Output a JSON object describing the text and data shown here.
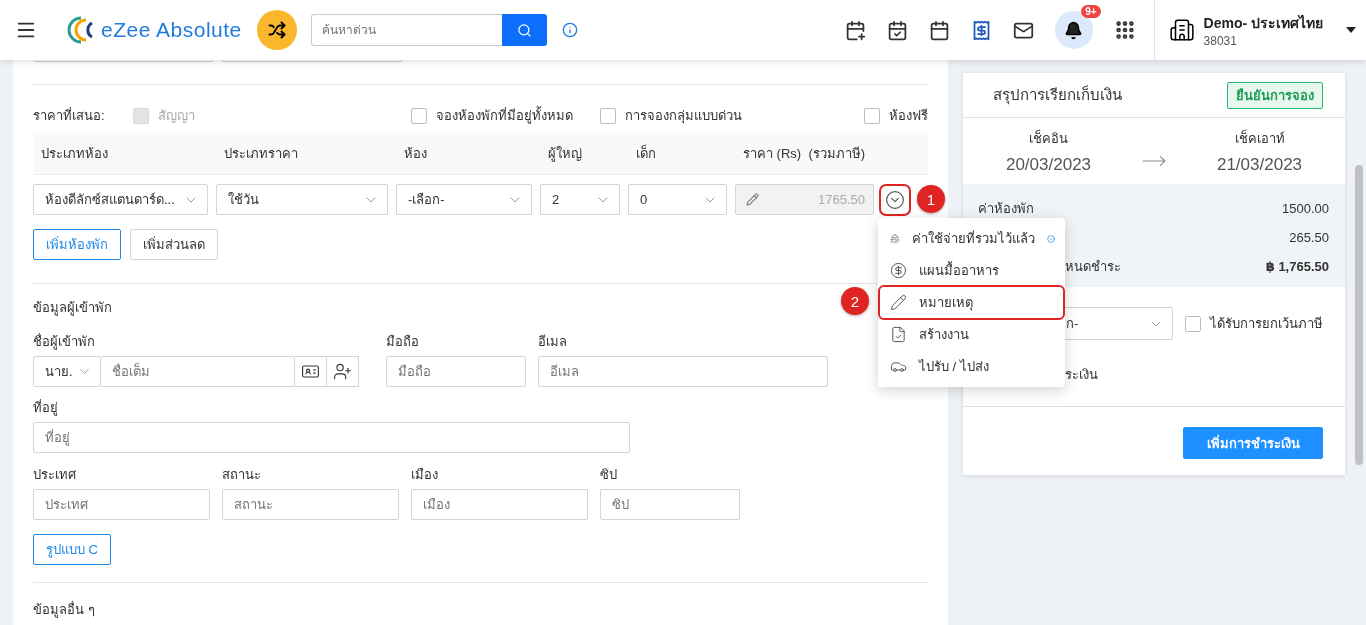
{
  "header": {
    "logo_text": "eZee Absolute",
    "search": {
      "placeholder": "ค้นหาด่วน"
    },
    "notification_badge": "9+",
    "property": {
      "name": "Demo- ประเทศไทย",
      "code": "38031"
    }
  },
  "booking": {
    "offered_rate_label": "ราคาที่เสนอ:",
    "options": [
      {
        "label": "สัญญา",
        "checked": false,
        "disabled": true
      },
      {
        "label": "จองห้องพักที่มีอยู่ทั้งหมด",
        "checked": false,
        "disabled": false
      },
      {
        "label": "การจองกลุ่มแบบด่วน",
        "checked": false,
        "disabled": false
      },
      {
        "label": "ห้องฟรี",
        "checked": false,
        "disabled": false
      }
    ],
    "columns": [
      "ประเภทห้อง",
      "ประเภทราคา",
      "ห้อง",
      "ผู้ใหญ่",
      "เด็ก",
      "ราคา (Rs)  (รวมภาษี)"
    ],
    "row": {
      "room_type": "ห้องดีลักซ์สแตนดาร์ด...",
      "rate_type": "ใช้วัน",
      "room": "-เลือก-",
      "adults": "2",
      "children": "0",
      "price": "1765.50"
    },
    "buttons": [
      "เพิ่มห้องพัก",
      "เพิ่มส่วนลด"
    ]
  },
  "guest": {
    "title": "ข้อมูลผู้เข้าพัก",
    "name_label": "ชื่อผู้เข้าพัก",
    "salutation": "นาย.",
    "name_placeholder": "ชื่อเต็ม",
    "mobile_label": "มือถือ",
    "mobile_placeholder": "มือถือ",
    "email_label": "อีเมล",
    "email_placeholder": "อีเมล",
    "address_label": "ที่อยู่",
    "address_placeholder": "ที่อยู่",
    "location_fields": [
      {
        "label": "ประเทศ",
        "placeholder": "ประเทศ"
      },
      {
        "label": "สถานะ",
        "placeholder": "สถานะ"
      },
      {
        "label": "เมือง",
        "placeholder": "เมือง"
      },
      {
        "label": "ซิป",
        "placeholder": "ซิป"
      }
    ],
    "form_button": "รูปแบบ C"
  },
  "other_info_title": "ข้อมูลอื่น ๆ",
  "summary": {
    "title": "สรุปการเรียกเก็บเงิน",
    "status": "ยืนยันการจอง",
    "check_in": {
      "label": "เช็คอิน",
      "date": "20/03/2023"
    },
    "check_out": {
      "label": "เช็คเอาท์",
      "date": "21/03/2023"
    },
    "charges": [
      {
        "label": "ค่าห้องพัก",
        "value": "1500.00"
      },
      {
        "value": "265.50"
      },
      {
        "label": "หนดชำระ",
        "value": "฿ 1,765.50"
      }
    ],
    "select_value": "ก-",
    "tax_exempt": {
      "label": "ได้รับการยกเว้นภาษี",
      "checked": false
    },
    "payment_text": "ระเงิน",
    "add_payment_button": "เพิ่มการชำระเงิน"
  },
  "row_menu": {
    "items": [
      {
        "label": "ค่าใช้จ่ายที่รวมไว้แล้ว",
        "checked": true
      },
      {
        "label": "แผนมื้ออาหาร",
        "checked": false
      },
      {
        "label": "หมายเหตุ",
        "checked": false
      },
      {
        "label": "สร้างงาน",
        "checked": false
      },
      {
        "label": "ไปรับ / ไปส่ง",
        "checked": false
      }
    ]
  },
  "annotations": [
    {
      "label": "1"
    },
    {
      "label": "2"
    }
  ]
}
